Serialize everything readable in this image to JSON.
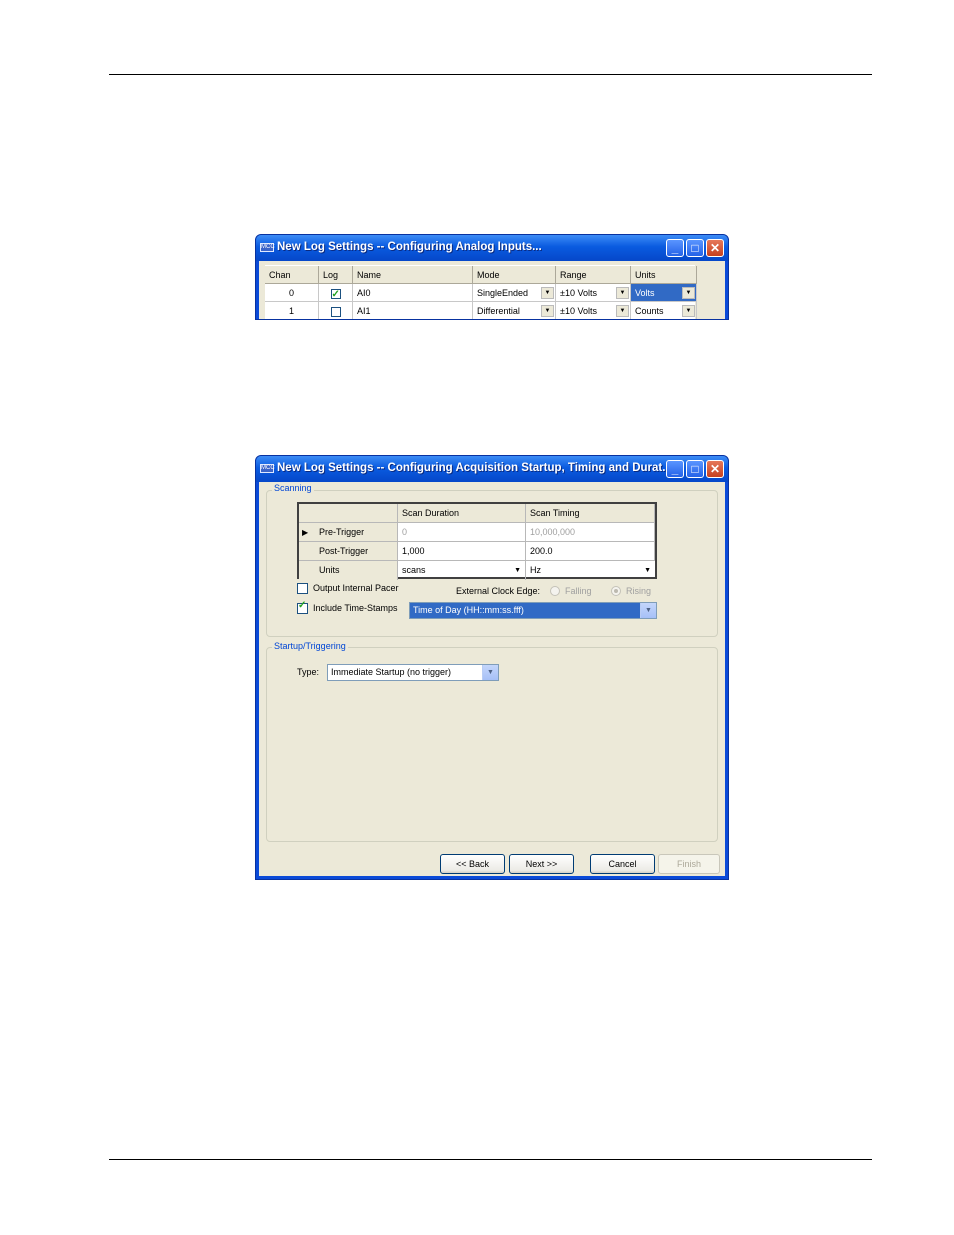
{
  "window1": {
    "title": "New Log Settings -- Configuring Analog Inputs...",
    "icon_text": "MCC",
    "columns": [
      "Chan",
      "Log",
      "Name",
      "Mode",
      "Range",
      "Units"
    ],
    "rows": [
      {
        "chan": "0",
        "log": true,
        "name": "AI0",
        "mode": "SingleEnded",
        "range": "±10 Volts",
        "units": "Volts",
        "units_selected": true
      },
      {
        "chan": "1",
        "log": false,
        "name": "AI1",
        "mode": "Differential",
        "range": "±10 Volts",
        "units": "Counts",
        "units_selected": false
      }
    ]
  },
  "window2": {
    "title": "New Log Settings -- Configuring Acquisition Startup, Timing and Durat...",
    "icon_text": "MCC",
    "scanning": {
      "legend": "Scanning",
      "columns": [
        "Scan Duration",
        "Scan Timing"
      ],
      "rows": [
        {
          "label": "Pre-Trigger",
          "duration": "0",
          "timing": "10,000,000",
          "disabled": true,
          "current": true
        },
        {
          "label": "Post-Trigger",
          "duration": "1,000",
          "timing": "200.0",
          "disabled": false,
          "current": false
        },
        {
          "label": "Units",
          "duration": "scans",
          "timing": "Hz",
          "disabled": false,
          "current": false
        }
      ],
      "output_pacer_label": "Output Internal Pacer",
      "output_pacer_checked": false,
      "clock_edge_label": "External Clock Edge:",
      "falling_label": "Falling",
      "rising_label": "Rising",
      "rising_selected": true,
      "timestamps_label": "Include Time-Stamps",
      "timestamps_checked": true,
      "timestamp_format": "Time of Day (HH::mm:ss.fff)"
    },
    "startup": {
      "legend": "Startup/Triggering",
      "type_label": "Type:",
      "type_value": "Immediate Startup (no trigger)"
    },
    "buttons": {
      "back": "<< Back",
      "next": "Next >>",
      "cancel": "Cancel",
      "finish": "Finish"
    }
  }
}
